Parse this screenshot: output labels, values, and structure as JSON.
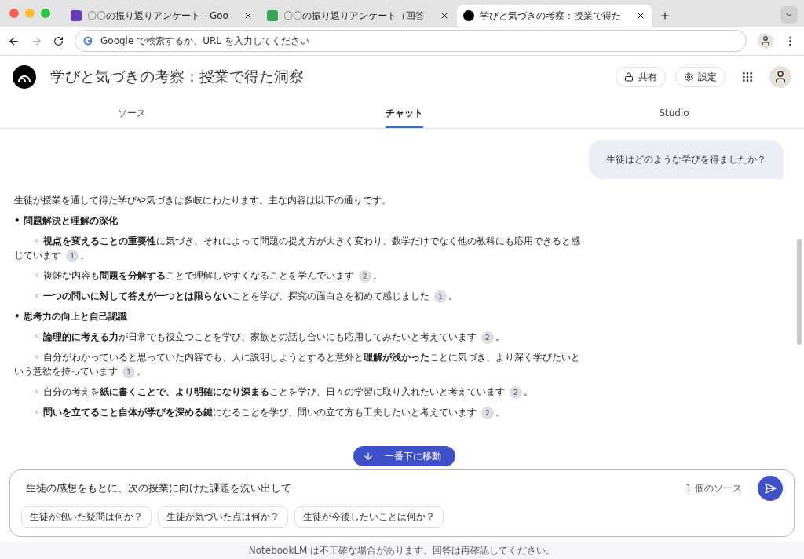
{
  "browser": {
    "tabs": [
      {
        "kind": "forms",
        "title": "〇〇の振り返りアンケート - Goo",
        "selected": false
      },
      {
        "kind": "sheets",
        "title": "〇〇の振り返りアンケート（回答",
        "selected": false
      },
      {
        "kind": "notebook",
        "title": "学びと気づきの考察：授業で得た",
        "selected": true
      }
    ],
    "address_placeholder": "Google で検索するか、URL を入力してください"
  },
  "header": {
    "title": "学びと気づきの考察：授業で得た洞察",
    "share": "共有",
    "settings": "設定"
  },
  "tabs": [
    {
      "label": "ソース",
      "selected": false
    },
    {
      "label": "チャット",
      "selected": true
    },
    {
      "label": "Studio",
      "selected": false
    }
  ],
  "chat": {
    "question": "生徒はどのような学びを得ましたか？",
    "answer": [
      {
        "kind": "para",
        "text": "生徒が授業を通して得た学びや気づきは多岐にわたります。主な内容は以下の通りです。"
      },
      {
        "kind": "heading",
        "marker": "•",
        "text": "問題解決と理解の深化"
      },
      {
        "kind": "item",
        "marker": "◦",
        "text": "**視点を変えることの重要性**に気づき、それによって問題の捉え方が大きく変わり、数学だけでなく他の教科にも応用できると感じています",
        "cite": "1",
        "end": "。"
      },
      {
        "kind": "item",
        "marker": "◦",
        "text": "複雑な内容も**問題を分解する**ことで理解しやすくなることを学んでいます",
        "cite": "2",
        "end": "。"
      },
      {
        "kind": "item",
        "marker": "◦",
        "text": "**一つの問いに対して答えが一つとは限らない**ことを学び、探究の面白さを初めて感じました",
        "cite": "1",
        "end": "。"
      },
      {
        "kind": "heading",
        "marker": "•",
        "text": "思考力の向上と自己認識"
      },
      {
        "kind": "item",
        "marker": "◦",
        "text": "**論理的に考える力**が日常でも役立つことを学び、家族との話し合いにも応用してみたいと考えています",
        "cite": "2",
        "end": "。"
      },
      {
        "kind": "item",
        "marker": "◦",
        "text": "自分がわかっていると思っていた内容でも、人に説明しようとすると意外と**理解が浅かった**ことに気づき、より深く学びたいという意欲を持っています",
        "cite": "1",
        "end": "。"
      },
      {
        "kind": "item",
        "marker": "◦",
        "text": "自分の考えを**紙に書くことで、より明確になり深まる**ことを学び、日々の学習に取り入れたいと考えています",
        "cite": "2",
        "end": "。"
      },
      {
        "kind": "item",
        "marker": "◦",
        "text": "**問いを立てること自体が学びを深める鍵**になることを学び、問いの立て方も工夫したいと考えています",
        "cite": "2",
        "end": "。"
      }
    ],
    "jump_button": "一番下に移動"
  },
  "composer": {
    "value": "生徒の感想をもとに、次の授業に向けた課題を洗い出して",
    "source_count": "1 個のソース",
    "suggestions": [
      "生徒が抱いた疑問は何か？",
      "生徒が気づいた点は何か？",
      "生徒が今後したいことは何か？"
    ]
  },
  "footer": "NotebookLM は不正確な場合があります。回答は再確認してください。"
}
